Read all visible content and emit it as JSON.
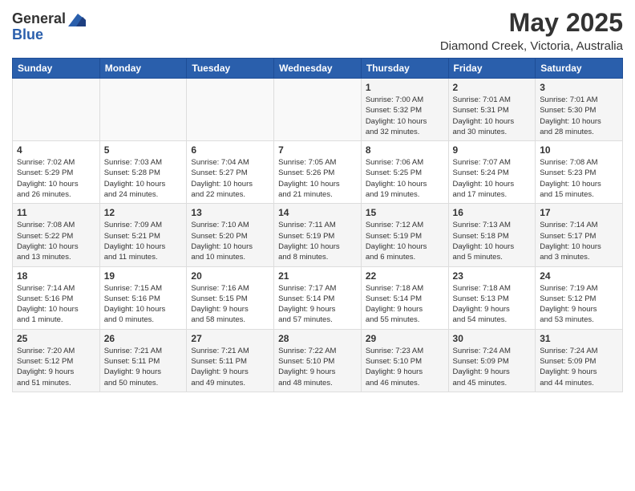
{
  "header": {
    "logo_general": "General",
    "logo_blue": "Blue",
    "month": "May 2025",
    "location": "Diamond Creek, Victoria, Australia"
  },
  "weekdays": [
    "Sunday",
    "Monday",
    "Tuesday",
    "Wednesday",
    "Thursday",
    "Friday",
    "Saturday"
  ],
  "weeks": [
    [
      {
        "day": "",
        "detail": ""
      },
      {
        "day": "",
        "detail": ""
      },
      {
        "day": "",
        "detail": ""
      },
      {
        "day": "",
        "detail": ""
      },
      {
        "day": "1",
        "detail": "Sunrise: 7:00 AM\nSunset: 5:32 PM\nDaylight: 10 hours\nand 32 minutes."
      },
      {
        "day": "2",
        "detail": "Sunrise: 7:01 AM\nSunset: 5:31 PM\nDaylight: 10 hours\nand 30 minutes."
      },
      {
        "day": "3",
        "detail": "Sunrise: 7:01 AM\nSunset: 5:30 PM\nDaylight: 10 hours\nand 28 minutes."
      }
    ],
    [
      {
        "day": "4",
        "detail": "Sunrise: 7:02 AM\nSunset: 5:29 PM\nDaylight: 10 hours\nand 26 minutes."
      },
      {
        "day": "5",
        "detail": "Sunrise: 7:03 AM\nSunset: 5:28 PM\nDaylight: 10 hours\nand 24 minutes."
      },
      {
        "day": "6",
        "detail": "Sunrise: 7:04 AM\nSunset: 5:27 PM\nDaylight: 10 hours\nand 22 minutes."
      },
      {
        "day": "7",
        "detail": "Sunrise: 7:05 AM\nSunset: 5:26 PM\nDaylight: 10 hours\nand 21 minutes."
      },
      {
        "day": "8",
        "detail": "Sunrise: 7:06 AM\nSunset: 5:25 PM\nDaylight: 10 hours\nand 19 minutes."
      },
      {
        "day": "9",
        "detail": "Sunrise: 7:07 AM\nSunset: 5:24 PM\nDaylight: 10 hours\nand 17 minutes."
      },
      {
        "day": "10",
        "detail": "Sunrise: 7:08 AM\nSunset: 5:23 PM\nDaylight: 10 hours\nand 15 minutes."
      }
    ],
    [
      {
        "day": "11",
        "detail": "Sunrise: 7:08 AM\nSunset: 5:22 PM\nDaylight: 10 hours\nand 13 minutes."
      },
      {
        "day": "12",
        "detail": "Sunrise: 7:09 AM\nSunset: 5:21 PM\nDaylight: 10 hours\nand 11 minutes."
      },
      {
        "day": "13",
        "detail": "Sunrise: 7:10 AM\nSunset: 5:20 PM\nDaylight: 10 hours\nand 10 minutes."
      },
      {
        "day": "14",
        "detail": "Sunrise: 7:11 AM\nSunset: 5:19 PM\nDaylight: 10 hours\nand 8 minutes."
      },
      {
        "day": "15",
        "detail": "Sunrise: 7:12 AM\nSunset: 5:19 PM\nDaylight: 10 hours\nand 6 minutes."
      },
      {
        "day": "16",
        "detail": "Sunrise: 7:13 AM\nSunset: 5:18 PM\nDaylight: 10 hours\nand 5 minutes."
      },
      {
        "day": "17",
        "detail": "Sunrise: 7:14 AM\nSunset: 5:17 PM\nDaylight: 10 hours\nand 3 minutes."
      }
    ],
    [
      {
        "day": "18",
        "detail": "Sunrise: 7:14 AM\nSunset: 5:16 PM\nDaylight: 10 hours\nand 1 minute."
      },
      {
        "day": "19",
        "detail": "Sunrise: 7:15 AM\nSunset: 5:16 PM\nDaylight: 10 hours\nand 0 minutes."
      },
      {
        "day": "20",
        "detail": "Sunrise: 7:16 AM\nSunset: 5:15 PM\nDaylight: 9 hours\nand 58 minutes."
      },
      {
        "day": "21",
        "detail": "Sunrise: 7:17 AM\nSunset: 5:14 PM\nDaylight: 9 hours\nand 57 minutes."
      },
      {
        "day": "22",
        "detail": "Sunrise: 7:18 AM\nSunset: 5:14 PM\nDaylight: 9 hours\nand 55 minutes."
      },
      {
        "day": "23",
        "detail": "Sunrise: 7:18 AM\nSunset: 5:13 PM\nDaylight: 9 hours\nand 54 minutes."
      },
      {
        "day": "24",
        "detail": "Sunrise: 7:19 AM\nSunset: 5:12 PM\nDaylight: 9 hours\nand 53 minutes."
      }
    ],
    [
      {
        "day": "25",
        "detail": "Sunrise: 7:20 AM\nSunset: 5:12 PM\nDaylight: 9 hours\nand 51 minutes."
      },
      {
        "day": "26",
        "detail": "Sunrise: 7:21 AM\nSunset: 5:11 PM\nDaylight: 9 hours\nand 50 minutes."
      },
      {
        "day": "27",
        "detail": "Sunrise: 7:21 AM\nSunset: 5:11 PM\nDaylight: 9 hours\nand 49 minutes."
      },
      {
        "day": "28",
        "detail": "Sunrise: 7:22 AM\nSunset: 5:10 PM\nDaylight: 9 hours\nand 48 minutes."
      },
      {
        "day": "29",
        "detail": "Sunrise: 7:23 AM\nSunset: 5:10 PM\nDaylight: 9 hours\nand 46 minutes."
      },
      {
        "day": "30",
        "detail": "Sunrise: 7:24 AM\nSunset: 5:09 PM\nDaylight: 9 hours\nand 45 minutes."
      },
      {
        "day": "31",
        "detail": "Sunrise: 7:24 AM\nSunset: 5:09 PM\nDaylight: 9 hours\nand 44 minutes."
      }
    ]
  ]
}
